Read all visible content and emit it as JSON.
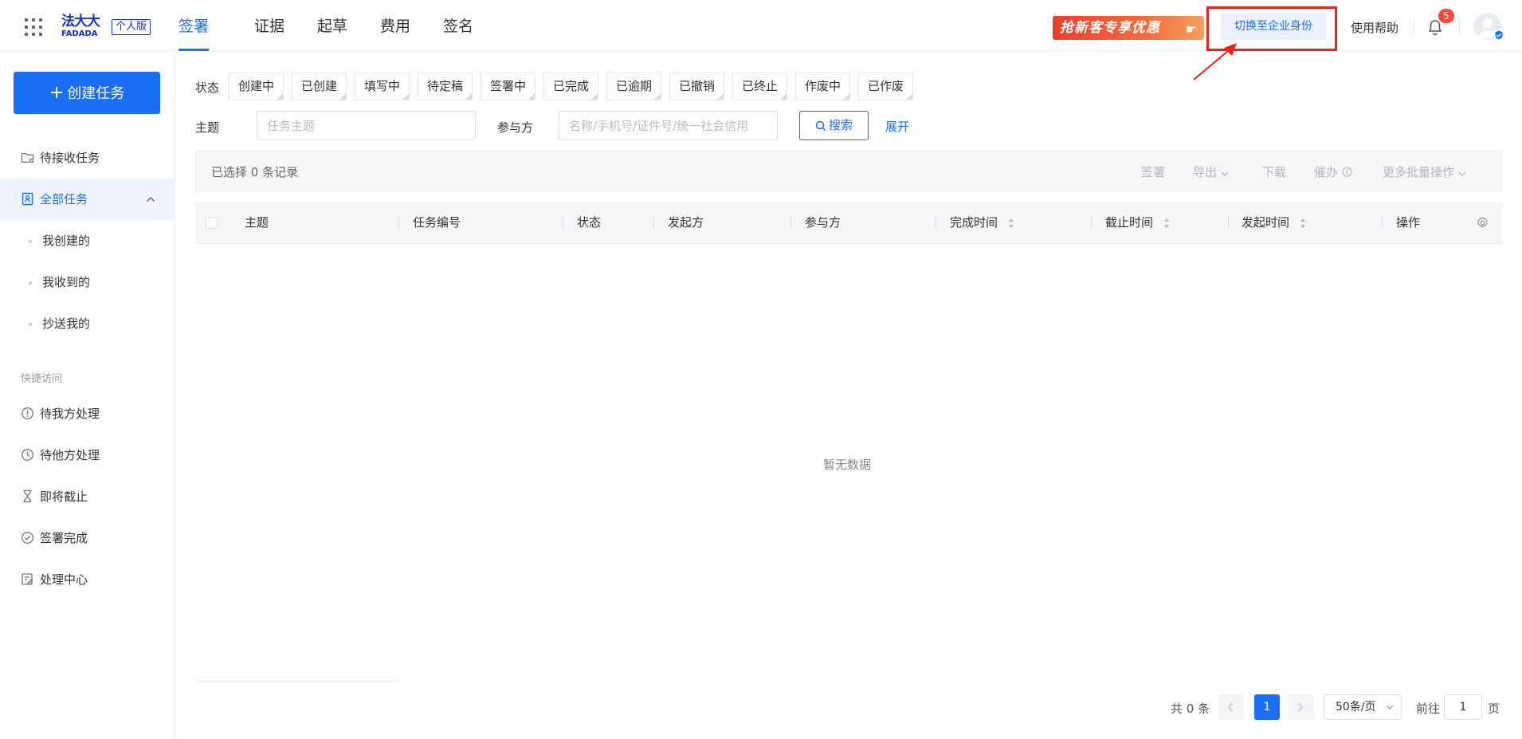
{
  "brand": {
    "logo_cn": "法大大",
    "logo_en": "FADADA",
    "edition": "个人版"
  },
  "nav": {
    "items": [
      {
        "label": "签署",
        "active": true
      },
      {
        "label": "证据",
        "active": false
      },
      {
        "label": "起草",
        "active": false
      },
      {
        "label": "费用",
        "active": false
      },
      {
        "label": "签名",
        "active": false
      }
    ]
  },
  "header": {
    "promo": "抢新客专享优惠",
    "switch_identity": "切换至企业身份",
    "help": "使用帮助",
    "notification_count": "5"
  },
  "sidebar": {
    "create_button": "创建任务",
    "pending_receive": "待接收任务",
    "all_tasks": "全部任务",
    "sub_items": [
      "我创建的",
      "我收到的",
      "抄送我的"
    ],
    "quick_access_title": "快捷访问",
    "quick_items": [
      "待我方处理",
      "待他方处理",
      "即将截止",
      "签署完成",
      "处理中心"
    ]
  },
  "filters": {
    "status_label": "状态",
    "statuses": [
      "创建中",
      "已创建",
      "填写中",
      "待定稿",
      "签署中",
      "已完成",
      "已逾期",
      "已撤销",
      "已终止",
      "作废中",
      "已作废"
    ],
    "subject_label": "主题",
    "subject_placeholder": "任务主题",
    "participant_label": "参与方",
    "participant_placeholder": "名称/手机号/证件号/统一社会信用",
    "search_button": "搜索",
    "expand": "展开"
  },
  "toolbar": {
    "selected_text": "已选择 0 条记录",
    "actions": [
      "签署",
      "导出",
      "下载",
      "催办",
      "更多批量操作"
    ]
  },
  "table": {
    "columns": [
      "主题",
      "任务编号",
      "状态",
      "发起方",
      "参与方",
      "完成时间",
      "截止时间",
      "发起时间",
      "操作"
    ],
    "rows": [],
    "empty_text": "暂无数据"
  },
  "pagination": {
    "total": "共 0 条",
    "current_page": "1",
    "page_size": "50条/页",
    "goto_prefix": "前往",
    "goto_value": "1",
    "goto_suffix": "页"
  },
  "colors": {
    "primary": "#1b6ff5",
    "highlight_box": "#e8231d",
    "badge": "#f5493b"
  }
}
